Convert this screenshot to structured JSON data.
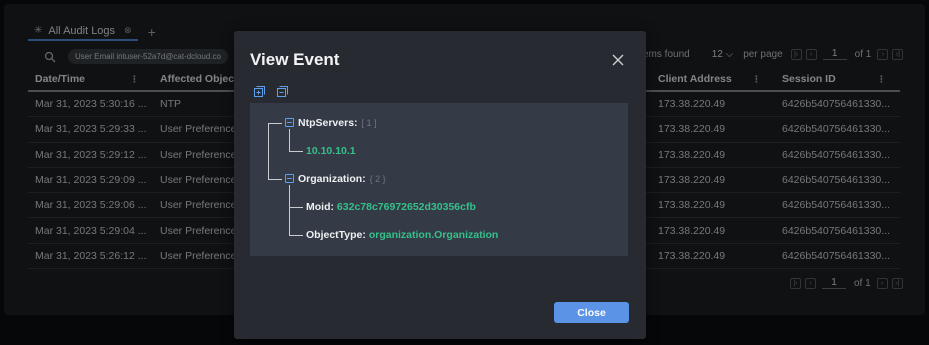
{
  "tabs": [
    {
      "label": "All Audit Logs"
    }
  ],
  "filter_chip": "User Email intuser-52a7d@cat-dcloud.co",
  "pager": {
    "items_found": "ems found",
    "per_page_value": "12",
    "per_page_label": "per page",
    "page": "1",
    "of": "of 1"
  },
  "table": {
    "headers": [
      "Date/Time",
      "Affected Object",
      "Client Address",
      "Session ID"
    ],
    "rows": [
      [
        "Mar 31, 2023 5:30:16 ...",
        "NTP",
        "173.38.220.49",
        "6426b540756461330..."
      ],
      [
        "Mar 31, 2023 5:29:33 ...",
        "User Preference",
        "173.38.220.49",
        "6426b540756461330..."
      ],
      [
        "Mar 31, 2023 5:29:12 ...",
        "User Preference",
        "173.38.220.49",
        "6426b540756461330..."
      ],
      [
        "Mar 31, 2023 5:29:09 ...",
        "User Preference",
        "173.38.220.49",
        "6426b540756461330..."
      ],
      [
        "Mar 31, 2023 5:29:06 ...",
        "User Preference",
        "173.38.220.49",
        "6426b540756461330..."
      ],
      [
        "Mar 31, 2023 5:29:04 ...",
        "User Preference",
        "173.38.220.49",
        "6426b540756461330..."
      ],
      [
        "Mar 31, 2023 5:26:12 ...",
        "User Preference",
        "173.38.220.49",
        "6426b540756461330..."
      ]
    ]
  },
  "modal": {
    "title": "View Event",
    "close_label": "Close",
    "tree": {
      "ntp_key": "NtpServers:",
      "ntp_count": "[ 1 ]",
      "ntp_value": "10.10.10.1",
      "org_key": "Organization:",
      "org_count": "{ 2 }",
      "moid_key": "Moid:",
      "moid_value": "632c78c76972652d30356cfb",
      "objtype_key": "ObjectType:",
      "objtype_value": "organization.Organization"
    }
  },
  "colors": {
    "accent": "#5b93e6",
    "value_green": "#35c08a",
    "background": "#1c1f23"
  },
  "icons": [
    "star-icon",
    "tab-close-icon",
    "add-tab-icon",
    "search-icon",
    "first-page-icon",
    "prev-page-icon",
    "next-page-icon",
    "last-page-icon",
    "modal-close-icon",
    "expand-all-icon",
    "collapse-all-icon"
  ]
}
